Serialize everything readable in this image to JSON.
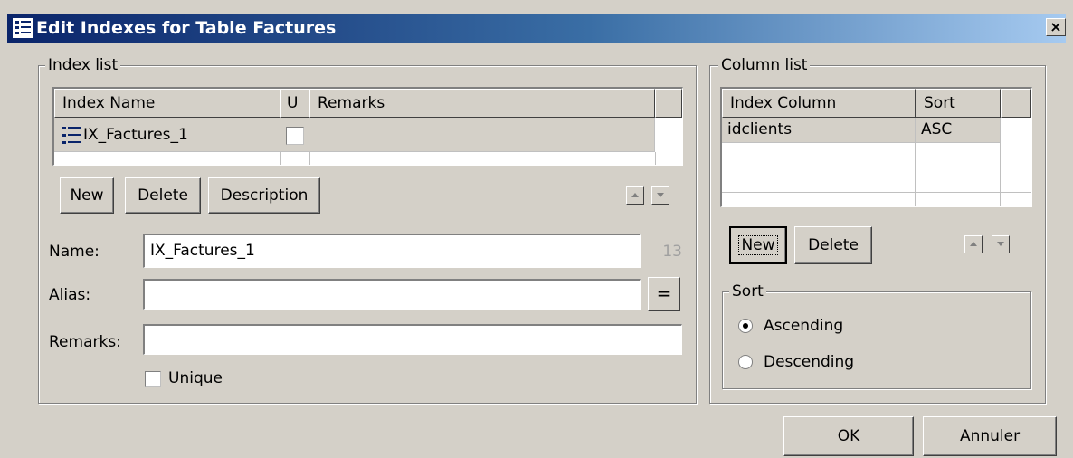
{
  "window": {
    "title": "Edit Indexes for Table Factures",
    "close_label": "×"
  },
  "index_list": {
    "legend": "Index list",
    "columns": [
      "Index Name",
      "U",
      "Remarks"
    ],
    "rows": [
      {
        "name": "IX_Factures_1",
        "unique": false,
        "remarks": ""
      }
    ],
    "buttons": {
      "new": "New",
      "delete": "Delete",
      "description": "Description"
    }
  },
  "fields": {
    "name_label": "Name:",
    "name_value": "IX_Factures_1",
    "name_length": "13",
    "alias_label": "Alias:",
    "alias_value": "",
    "alias_button": "=",
    "remarks_label": "Remarks:",
    "remarks_value": "",
    "unique_label": "Unique",
    "unique_checked": false
  },
  "column_list": {
    "legend": "Column list",
    "columns": [
      "Index Column",
      "Sort"
    ],
    "rows": [
      {
        "column": "idclients",
        "sort": "ASC"
      }
    ],
    "buttons": {
      "new": "New",
      "delete": "Delete"
    }
  },
  "sort_group": {
    "legend": "Sort",
    "options": [
      "Ascending",
      "Descending"
    ],
    "selected": "Ascending"
  },
  "footer": {
    "ok": "OK",
    "cancel": "Annuler"
  },
  "icons": {
    "title_icon": "index-list-icon",
    "row_icon": "index-list-icon",
    "move_up": "arrow-up-icon",
    "move_down": "arrow-down-icon"
  }
}
